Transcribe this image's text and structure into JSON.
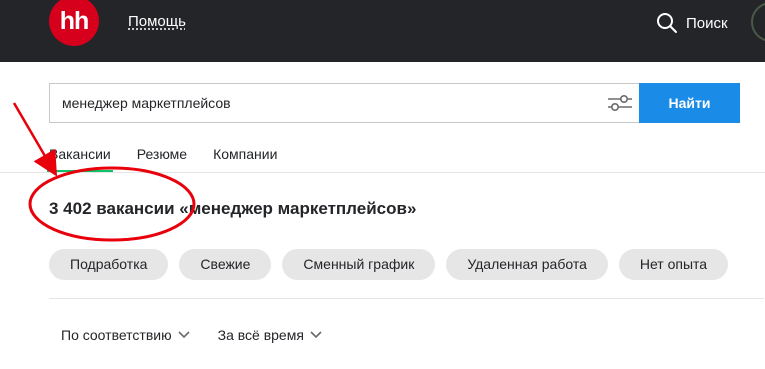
{
  "header": {
    "logo_text": "hh",
    "help_label": "Помощь",
    "search_label": "Поиск"
  },
  "search": {
    "value": "менеджер маркетплейсов",
    "button_label": "Найти"
  },
  "tabs": [
    {
      "label": "Вакансии",
      "active": true
    },
    {
      "label": "Резюме",
      "active": false
    },
    {
      "label": "Компании",
      "active": false
    }
  ],
  "results": {
    "title": "3 402 вакансии «менеджер маркетплейсов»"
  },
  "chips": [
    {
      "label": "Подработка"
    },
    {
      "label": "Свежие"
    },
    {
      "label": "Сменный график"
    },
    {
      "label": "Удаленная работа"
    },
    {
      "label": "Нет опыта"
    }
  ],
  "sort": {
    "order_label": "По соответствию",
    "period_label": "За всё время"
  },
  "colors": {
    "header_bg": "#232529",
    "logo_red": "#d6001c",
    "accent_blue": "#1a8be6",
    "tab_active_green": "#0dc267",
    "chip_bg": "#e6e6e6",
    "annotation_red": "#e8000b"
  },
  "icons": {
    "search": "search-icon",
    "filter": "filter-sliders-icon",
    "chevron": "chevron-down-icon"
  }
}
